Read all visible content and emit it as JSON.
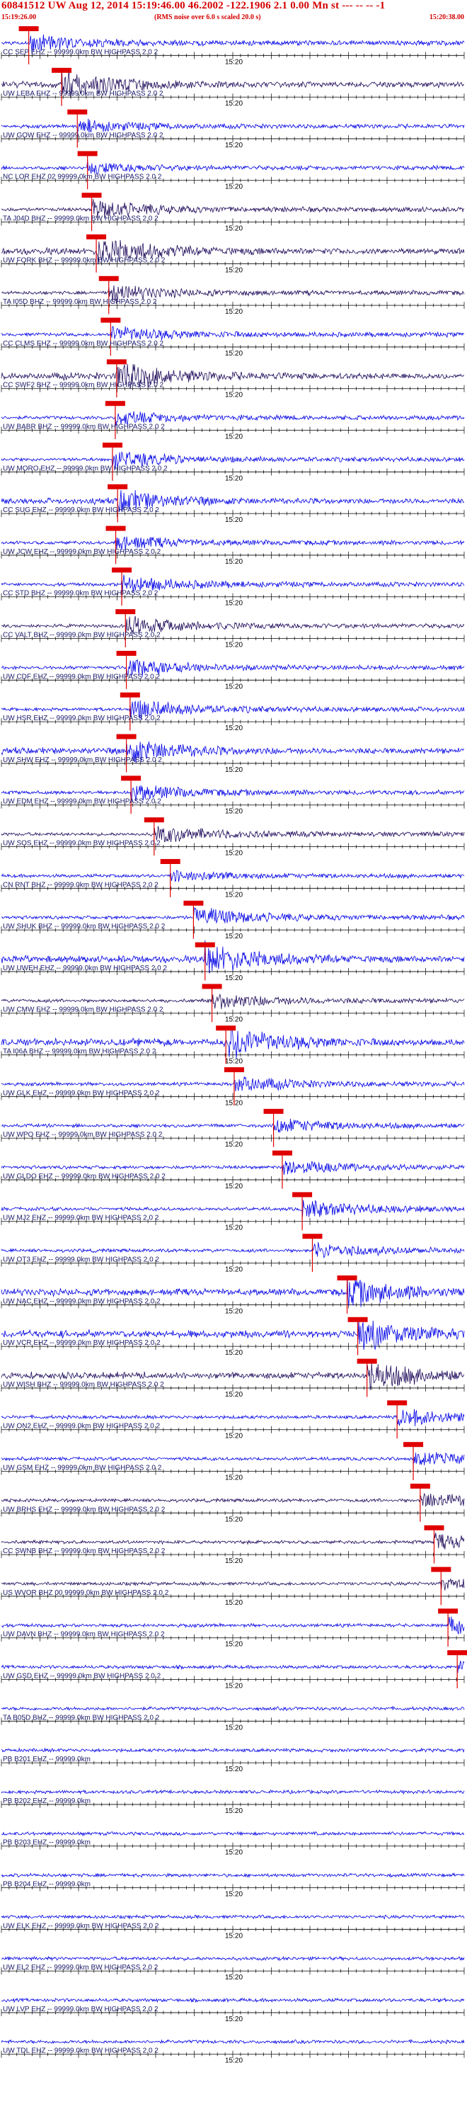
{
  "header": {
    "title": "60841512 UW Aug 12, 2014 15:19:46.00   46.2002 -122.1906  2.1 0.00 Mn st --- -- --  -1",
    "start_time": "15:19:26.00",
    "note": "(RMS noise over 6.0 s scaled 20.0 s)",
    "end_time": "15:20:38.00"
  },
  "time_mark": "15:20",
  "colors": {
    "header": "#d40000",
    "blue_trace": "#0000e6",
    "dark_trace": "#1e0a5a",
    "marker": "#e00000",
    "axis": "#000000"
  },
  "traces": [
    {
      "label": "CC SEP EHZ -- 99999.0km BW  HIGHPASS  2.0  2",
      "color": "blue",
      "pick": 0.059,
      "amp": 0.55
    },
    {
      "label": "UW LEBA EHZ -- 99999.0km BW  HIGHPASS  2.0  2",
      "color": "dark",
      "pick": 0.13,
      "amp": 0.9
    },
    {
      "label": "UW GOW EHZ -- 99999.0km BW  HIGHPASS  2.0  2",
      "color": "blue",
      "pick": 0.164,
      "amp": 0.4
    },
    {
      "label": "NC LOR EHZ 02 99999.0km BW  HIGHPASS  2.0  2",
      "color": "blue",
      "pick": 0.186,
      "amp": 0.35
    },
    {
      "label": "TA J04D BHZ -- 99999.0km BW  HIGHPASS  2.0  2",
      "color": "dark",
      "pick": 0.195,
      "amp": 0.6
    },
    {
      "label": "UW FORK BHZ -- 99999.0km BW  HIGHPASS  2.0  2",
      "color": "dark",
      "pick": 0.205,
      "amp": 0.9
    },
    {
      "label": "TA I05D BHZ -- 99999.0km BW  HIGHPASS  2.0  2",
      "color": "dark",
      "pick": 0.232,
      "amp": 0.5
    },
    {
      "label": "CC CLMS EHZ -- 99999.0km BW  HIGHPASS  2.0  2",
      "color": "blue",
      "pick": 0.236,
      "amp": 0.5
    },
    {
      "label": "CC SWF2 BHZ -- 99999.0km BW  HIGHPASS  2.0  2",
      "color": "dark",
      "pick": 0.249,
      "amp": 0.95
    },
    {
      "label": "UW BABR BHZ -- 99999.0km BW  HIGHPASS  2.0  2",
      "color": "blue",
      "pick": 0.246,
      "amp": 0.4
    },
    {
      "label": "UW MORO EHZ -- 99999.0km BW  HIGHPASS  2.0  2",
      "color": "blue",
      "pick": 0.24,
      "amp": 0.5
    },
    {
      "label": "CC SUG EHZ -- 99999.0km BW  HIGHPASS  2.0  2",
      "color": "blue",
      "pick": 0.251,
      "amp": 0.7
    },
    {
      "label": "UW JCW EHZ -- 99999.0km BW  HIGHPASS  2.0  2",
      "color": "blue",
      "pick": 0.247,
      "amp": 0.45
    },
    {
      "label": "CC STD BHZ -- 99999.0km BW  HIGHPASS  2.0  2",
      "color": "blue",
      "pick": 0.26,
      "amp": 0.55
    },
    {
      "label": "CC VALT BHZ -- 99999.0km BW  HIGHPASS  2.0  2",
      "color": "dark",
      "pick": 0.268,
      "amp": 0.55
    },
    {
      "label": "UW CDF EHZ -- 99999.0km BW  HIGHPASS  2.0  2",
      "color": "blue",
      "pick": 0.27,
      "amp": 0.5
    },
    {
      "label": "UW HSR EHZ -- 99999.0km BW  HIGHPASS  2.0  2",
      "color": "blue",
      "pick": 0.278,
      "amp": 0.6
    },
    {
      "label": "UW SHW EHZ -- 99999.0km BW  HIGHPASS  2.0  2",
      "color": "blue",
      "pick": 0.27,
      "amp": 0.8
    },
    {
      "label": "UW EDM EHZ -- 99999.0km BW  HIGHPASS  2.0  2",
      "color": "blue",
      "pick": 0.28,
      "amp": 0.5
    },
    {
      "label": "UW SOS EHZ -- 99999.0km BW  HIGHPASS  2.0  2",
      "color": "dark",
      "pick": 0.33,
      "amp": 0.55
    },
    {
      "label": "CN RNT BHZ -- 99999.0km BW  HIGHPASS  2.0  2",
      "color": "blue",
      "pick": 0.365,
      "amp": 0.35
    },
    {
      "label": "UW SHUK BHZ -- 99999.0km BW  HIGHPASS  2.0  2",
      "color": "blue",
      "pick": 0.415,
      "amp": 0.6
    },
    {
      "label": "UW UWEH EHZ -- 99999.0km BW  HIGHPASS  2.0  2",
      "color": "blue",
      "pick": 0.44,
      "amp": 0.95
    },
    {
      "label": "UW CMW EHZ -- 99999.0km BW  HIGHPASS  2.0  2",
      "color": "dark",
      "pick": 0.455,
      "amp": 0.5
    },
    {
      "label": "TA I06A BHZ -- 99999.0km BW  HIGHPASS  2.0  2",
      "color": "blue",
      "pick": 0.485,
      "amp": 1.0
    },
    {
      "label": "UW GLK EHZ -- 99999.0km BW  HIGHPASS  2.0  2",
      "color": "blue",
      "pick": 0.503,
      "amp": 0.5
    },
    {
      "label": "UW WPO EHZ -- 99999.0km BW  HIGHPASS  2.0  2",
      "color": "blue",
      "pick": 0.588,
      "amp": 0.45
    },
    {
      "label": "UW GLDO EHZ -- 99999.0km BW  HIGHPASS  2.0  2",
      "color": "blue",
      "pick": 0.607,
      "amp": 0.45
    },
    {
      "label": "UW MJ2 EHZ -- 99999.0km BW  HIGHPASS  2.0  2",
      "color": "blue",
      "pick": 0.65,
      "amp": 0.55
    },
    {
      "label": "UW OT3 EHZ -- 99999.0km BW  HIGHPASS  2.0  2",
      "color": "blue",
      "pick": 0.672,
      "amp": 0.5
    },
    {
      "label": "UW NAC EHZ -- 99999.0km BW  HIGHPASS  2.0  2",
      "color": "blue",
      "pick": 0.747,
      "amp": 0.9
    },
    {
      "label": "UW VCR EHZ -- 99999.0km BW  HIGHPASS  2.0  2",
      "color": "blue",
      "pick": 0.77,
      "amp": 1.0
    },
    {
      "label": "UW WISH BHZ -- 99999.0km BW  HIGHPASS  2.0  2",
      "color": "dark",
      "pick": 0.79,
      "amp": 0.9
    },
    {
      "label": "UW ON2 EHZ -- 99999.0km BW  HIGHPASS  2.0  2",
      "color": "blue",
      "pick": 0.855,
      "amp": 0.55
    },
    {
      "label": "UW GSM EHZ -- 99999.0km BW  HIGHPASS  2.0  2",
      "color": "blue",
      "pick": 0.89,
      "amp": 0.45
    },
    {
      "label": "UW BRHS EHZ -- 99999.0km BW  HIGHPASS  2.0  2",
      "color": "dark",
      "pick": 0.905,
      "amp": 0.5
    },
    {
      "label": "CC SWNB BHZ -- 99999.0km BW  HIGHPASS  2.0  2",
      "color": "dark",
      "pick": 0.935,
      "amp": 0.45
    },
    {
      "label": "US WVOR BHZ 00 99999.0km BW  HIGHPASS  2.0  2",
      "color": "dark",
      "pick": 0.95,
      "amp": 0.35
    },
    {
      "label": "UW DAVN BHZ -- 99999.0km BW  HIGHPASS  2.0  2",
      "color": "blue",
      "pick": 0.965,
      "amp": 0.45
    },
    {
      "label": "UW GSD EHZ -- 99999.0km BW  HIGHPASS  2.0  2",
      "color": "blue",
      "pick": 0.985,
      "amp": 0.4
    },
    {
      "label": "TA B05D BHZ -- 99999.0km BW  HIGHPASS  2.0  2",
      "color": "blue",
      "pick": null,
      "amp": 0.3
    },
    {
      "label": "PB B201 EHZ -- 99999.0km",
      "color": "blue",
      "pick": null,
      "amp": 0.0
    },
    {
      "label": "PB B202 EHZ -- 99999.0km",
      "color": "blue",
      "pick": null,
      "amp": 0.0
    },
    {
      "label": "PB B203 EHZ -- 99999.0km",
      "color": "blue",
      "pick": null,
      "amp": 0.0
    },
    {
      "label": "PB B204 EHZ -- 99999.0km",
      "color": "blue",
      "pick": null,
      "amp": 0.25
    },
    {
      "label": "UW ELK EHZ -- 99999.0km BW  HIGHPASS  2.0  2",
      "color": "blue",
      "pick": null,
      "amp": 0.35
    },
    {
      "label": "UW EL2 EHZ -- 99999.0km BW  HIGHPASS  2.0  2",
      "color": "blue",
      "pick": null,
      "amp": 0.35
    },
    {
      "label": "UW LVP EHZ -- 99999.0km BW  HIGHPASS  2.0  2",
      "color": "blue",
      "pick": null,
      "amp": 0.4
    },
    {
      "label": "UW TDL EHZ -- 99999.0km BW  HIGHPASS  2.0  2",
      "color": "blue",
      "pick": null,
      "amp": 0.4
    }
  ]
}
